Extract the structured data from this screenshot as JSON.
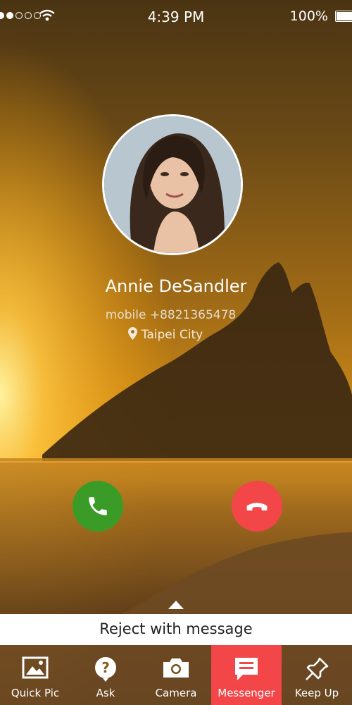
{
  "status_bar": {
    "time": "4:39 PM",
    "battery_percent": "100%",
    "signal_bars": 5,
    "signal_filled": 2
  },
  "caller": {
    "name": "Annie DeSandler",
    "number_line": "mobile +8821365478",
    "location": "Taipei City"
  },
  "actions": {
    "accept_icon": "phone-icon",
    "decline_icon": "hang-up-icon"
  },
  "reject_message": {
    "label": "Reject with message"
  },
  "bottom_bar": {
    "items": [
      {
        "label": "Quick Pic",
        "icon": "picture-icon",
        "active": false
      },
      {
        "label": "Ask",
        "icon": "question-icon",
        "active": false
      },
      {
        "label": "Camera",
        "icon": "camera-icon",
        "active": false
      },
      {
        "label": "Messenger",
        "icon": "chat-icon",
        "active": true
      },
      {
        "label": "Keep Up",
        "icon": "pin-icon",
        "active": false
      }
    ],
    "active_color": "#f24649"
  },
  "colors": {
    "accept": "#3b9b27",
    "decline": "#f24649",
    "sky": "#c98a1b"
  }
}
